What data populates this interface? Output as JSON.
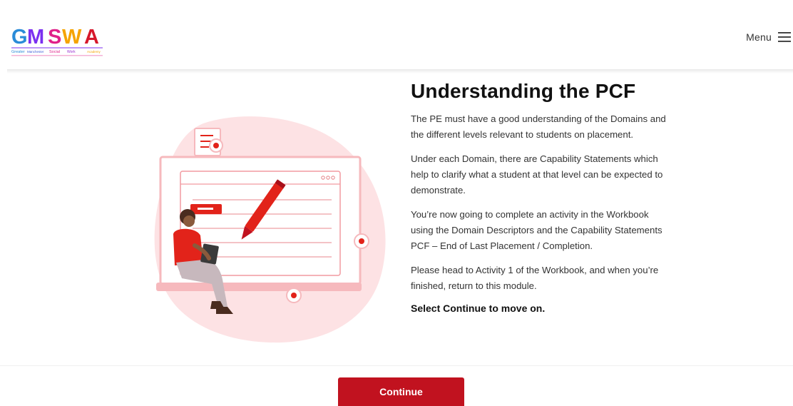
{
  "brand": {
    "logo_text": "GMSWA",
    "logo_subtitle": "Greater Manchester Social Work Academy",
    "accent_color": "#c1121f"
  },
  "header": {
    "menu_label": "Menu",
    "menu_icon": "hamburger-icon"
  },
  "main": {
    "title": "Understanding the PCF",
    "paragraphs": [
      "The PE must have a good understanding of the Domains and the different levels relevant to students on placement.",
      "Under each Domain, there are Capability Statements which help to clarify what a student at that level can be expected to demonstrate.",
      "You’re now going to complete an activity in the Workbook using the Domain Descriptors and the Capability Statements PCF – End of Last Placement / Completion.",
      "Please head to Activity 1 of the Workbook, and when you’re finished, return to this module."
    ],
    "instruction": "Select Continue to move on."
  },
  "footer": {
    "continue_label": "Continue"
  }
}
